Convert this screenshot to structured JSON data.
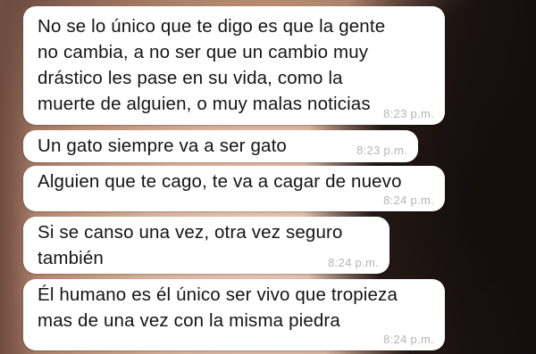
{
  "messages": [
    {
      "text": "No se lo único que te digo es que la gente\nno cambia, a no ser que un cambio muy\ndrástico les pase en su vida, como la\nmuerte de alguien, o muy malas noticias",
      "time": "8:23 p.m."
    },
    {
      "text": "Un gato siempre va a ser gato",
      "time": "8:23 p.m."
    },
    {
      "text": "Alguien que te cago, te va a cagar de nuevo",
      "time": "8:24 p.m."
    },
    {
      "text": "Si se canso una vez, otra vez seguro\ntambién",
      "time": "8:24 p.m."
    },
    {
      "text": "Él humano es él único ser vivo que tropieza\nmas de una vez con la misma piedra",
      "time": "8:24 p.m."
    }
  ],
  "colors": {
    "bubble": "#ffffff",
    "text": "#141414",
    "timestamp": "#b4b4b4"
  }
}
